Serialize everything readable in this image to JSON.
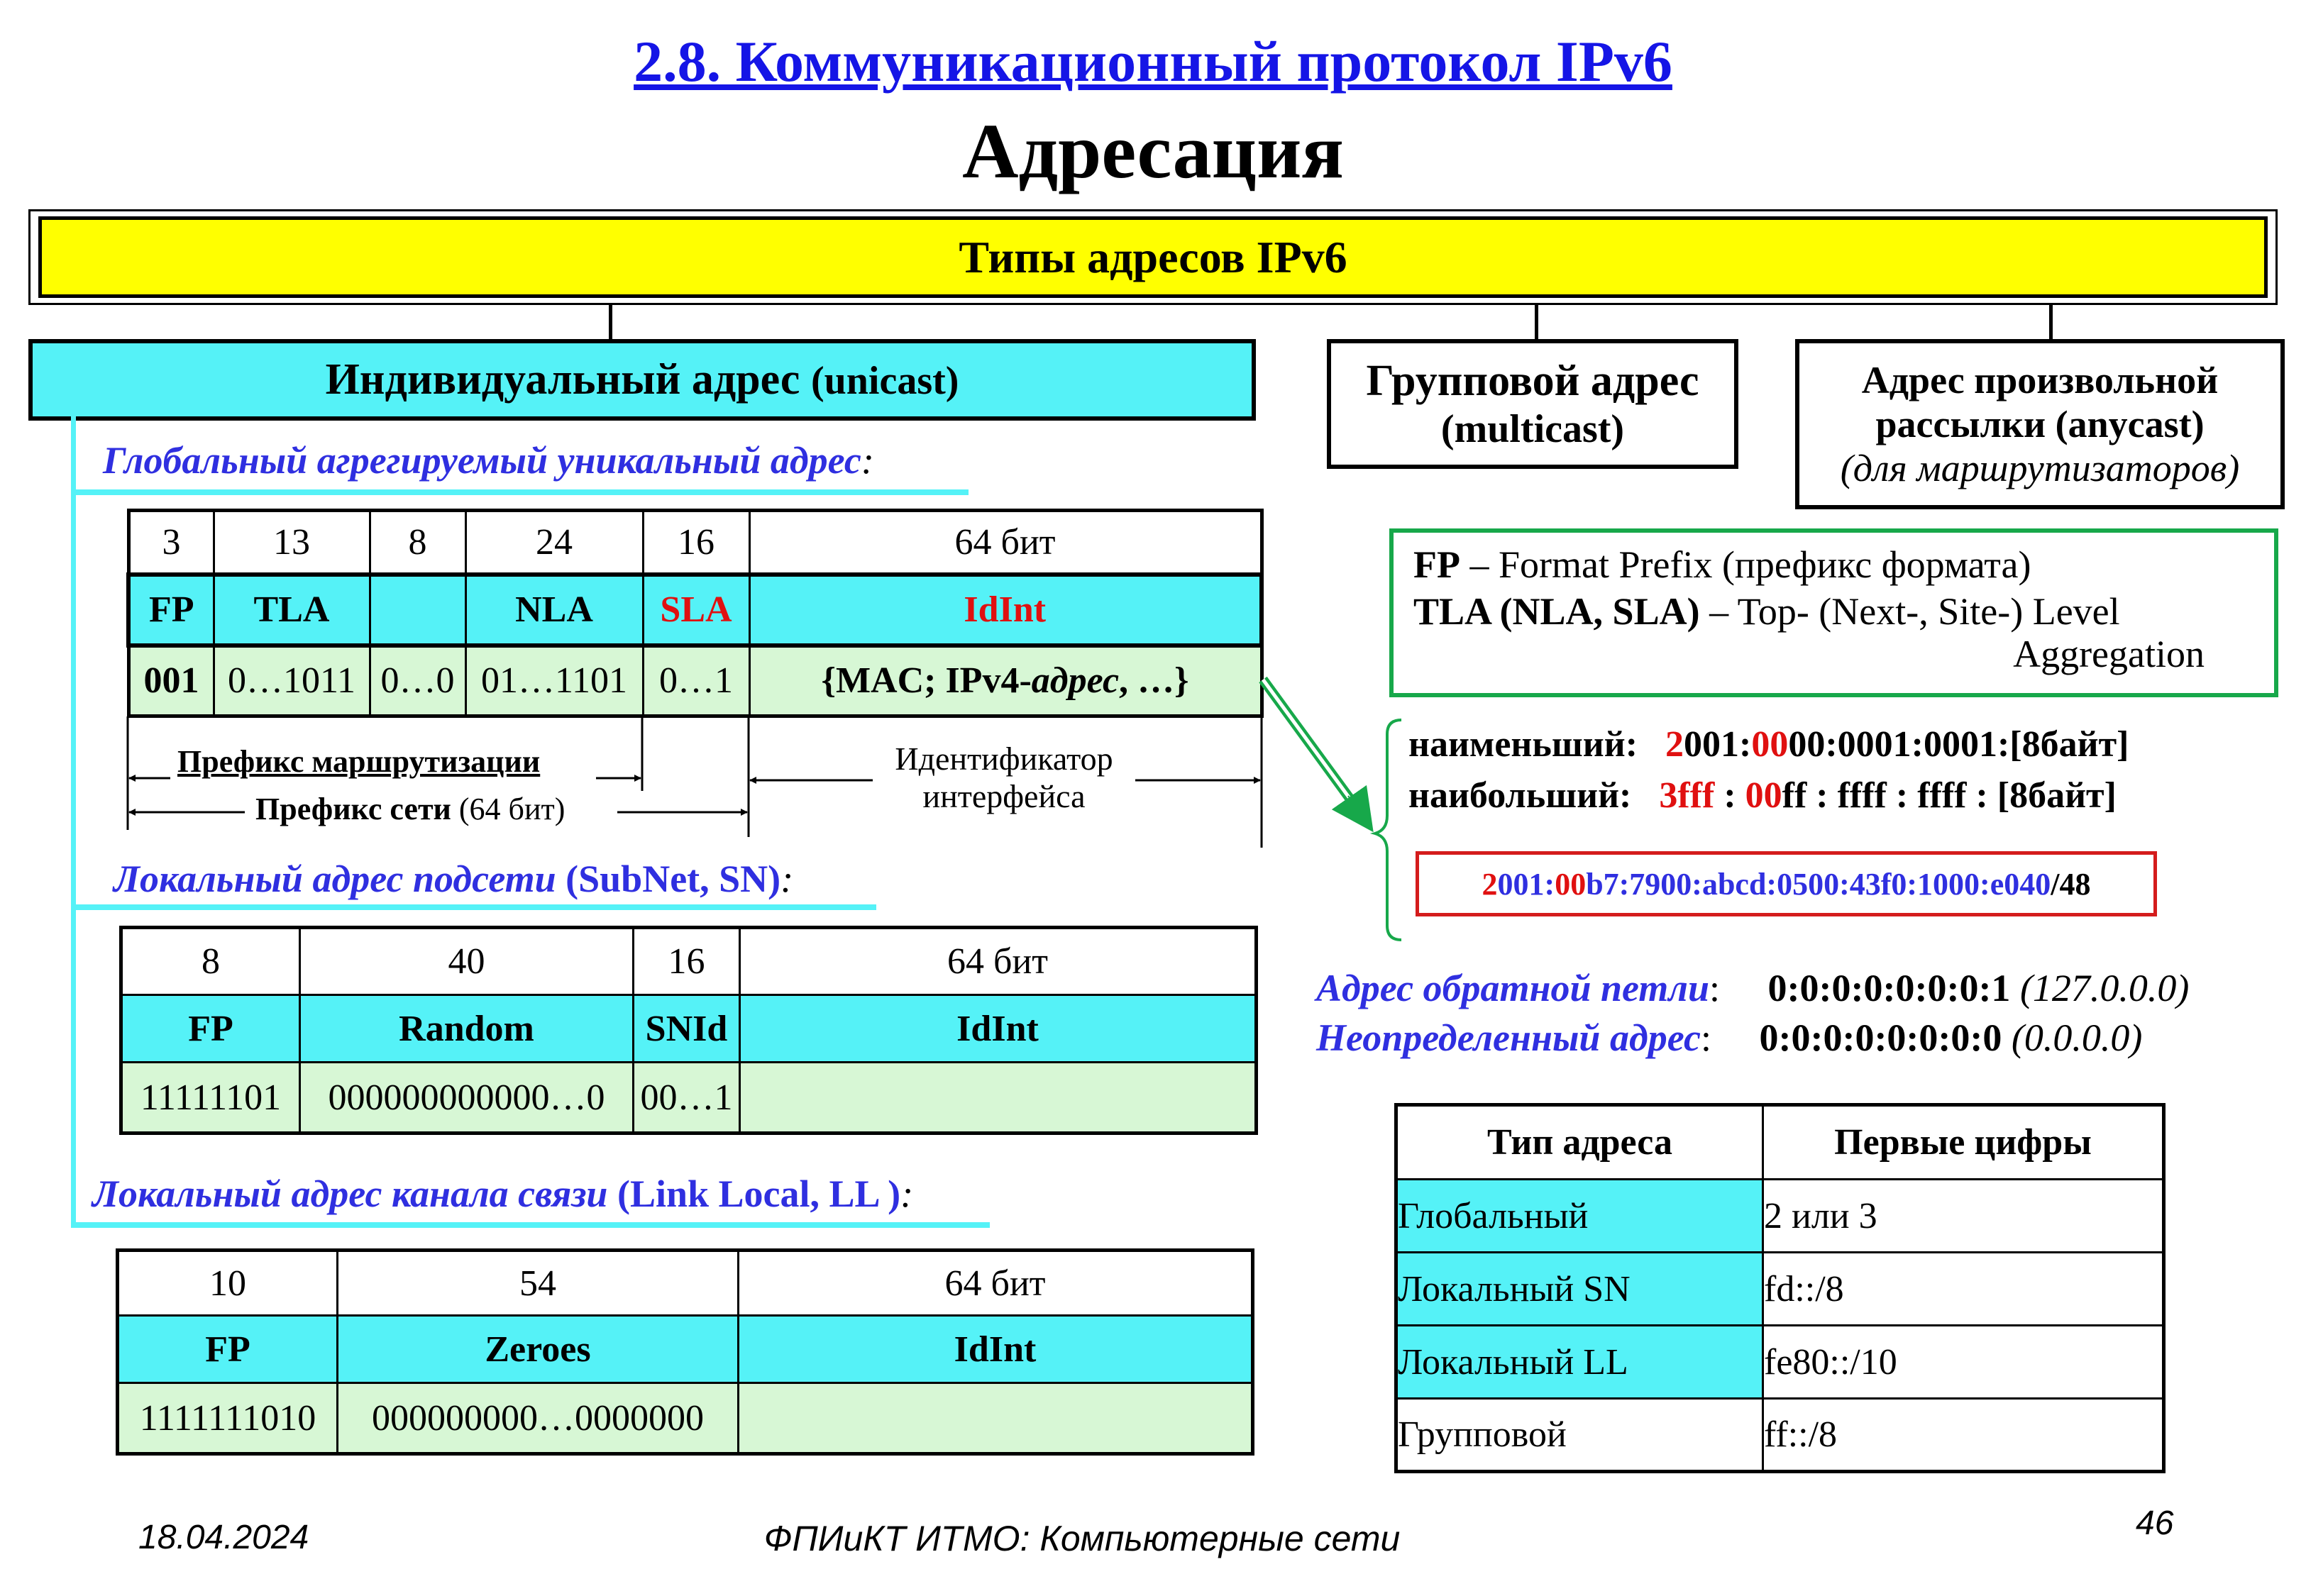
{
  "slide": {
    "title": "2.8. Коммуникационный протокол  IPv6",
    "subtitle": "Адресация",
    "date": "18.04.2024",
    "footer": "ФПИиКТ ИТМО: Компьютерные сети",
    "page_number": "46"
  },
  "tree": {
    "root": "Типы адресов IPv6",
    "unicast": {
      "label": "Индивидуальный адрес",
      "suffix": "(unicast)"
    },
    "multicast": {
      "line1": "Групповой адрес",
      "line2": "(multicast)"
    },
    "anycast": {
      "line1": "Адрес произвольной",
      "line2": "рассылки (anycast)",
      "line3": "(для маршрутизаторов)"
    }
  },
  "global": {
    "heading": "Глобальный агрегируемый уникальный адрес",
    "heading_suffix": ":",
    "bits": [
      "3",
      "13",
      "8",
      "24",
      "16",
      "64 бит"
    ],
    "fields": [
      "FP",
      "TLA",
      "",
      "NLA",
      "SLA",
      "IdInt"
    ],
    "values": [
      "001",
      "0…1011",
      "0…0",
      "01…1101",
      "0…1",
      "{MAC; IPv4-",
      "адрес",
      ", …}"
    ],
    "routing_prefix": "Префикс маршрутизации",
    "network_prefix": "Префикс сети",
    "network_prefix_note": "(64 бит)",
    "iface_id_line1": "Идентификатор",
    "iface_id_line2": "интерфейса"
  },
  "subnet": {
    "heading": "Локальный адрес подсети",
    "heading_abbr": "(SubNet, SN)",
    "heading_suffix": ":",
    "bits": [
      "8",
      "40",
      "16",
      "64 бит"
    ],
    "fields": [
      "FP",
      "Random",
      "SNId",
      "IdInt"
    ],
    "values": [
      "11111101",
      "000000000000…0",
      "00…1",
      ""
    ]
  },
  "linklocal": {
    "heading": "Локальный адрес канала связи",
    "heading_abbr": "(Link Local, LL )",
    "heading_suffix": ":",
    "bits": [
      "10",
      "54",
      "64 бит"
    ],
    "fields": [
      "FP",
      "Zeroes",
      "IdInt"
    ],
    "values": [
      "1111111010",
      "000000000…0000000",
      ""
    ]
  },
  "legend": {
    "fp_term": "FP",
    "fp_def": " – Format Prefix (префикс формата)",
    "tla_term": "TLA (NLA, SLA)",
    "tla_def": "  – Top- (Next-, Site-) Level",
    "tla_def2": "Aggregation"
  },
  "range": {
    "min_label": "наименьший:",
    "min_red1": "2",
    "min_mid": "001:",
    "min_red2": "00",
    "min_rest": "00:0001:0001:[8байт]",
    "max_label": "наибольший:",
    "max_red1": "3fff",
    "max_mid": " : ",
    "max_red2": "00",
    "max_rest": "ff : ffff : ffff : [8байт]",
    "example_red1": "2",
    "example_blue1": "001:",
    "example_red2": "00",
    "example_blue2": "b7:7900:abcd:0500:43f0:1000:e040",
    "example_suffix": "/48"
  },
  "special": {
    "loopback_label": "Адрес обратной петли",
    "loopback_value": "0:0:0:0:0:0:0:1",
    "loopback_v4": "(127.0.0.0)",
    "unspec_label": "Неопределенный адрес",
    "unspec_value": "0:0:0:0:0:0:0:0",
    "unspec_v4": "(0.0.0.0)"
  },
  "prefix_table": {
    "headers": [
      "Тип адреса",
      "Первые цифры"
    ],
    "rows": [
      [
        "Глобальный",
        "2 или 3"
      ],
      [
        "Локальный SN",
        "fd::/8"
      ],
      [
        "Локальный LL",
        "fe80::/10"
      ],
      [
        "Групповой",
        "ff::/8"
      ]
    ]
  },
  "colors": {
    "title_blue": "#1515e6",
    "heading_blue": "#2f2fe0",
    "cyan": "#55f2f7",
    "light_green": "#d7f7d5",
    "yellow": "#ffff00",
    "red": "#e01010",
    "frame_green": "#17a84a",
    "example_border": "#d41c1c"
  }
}
